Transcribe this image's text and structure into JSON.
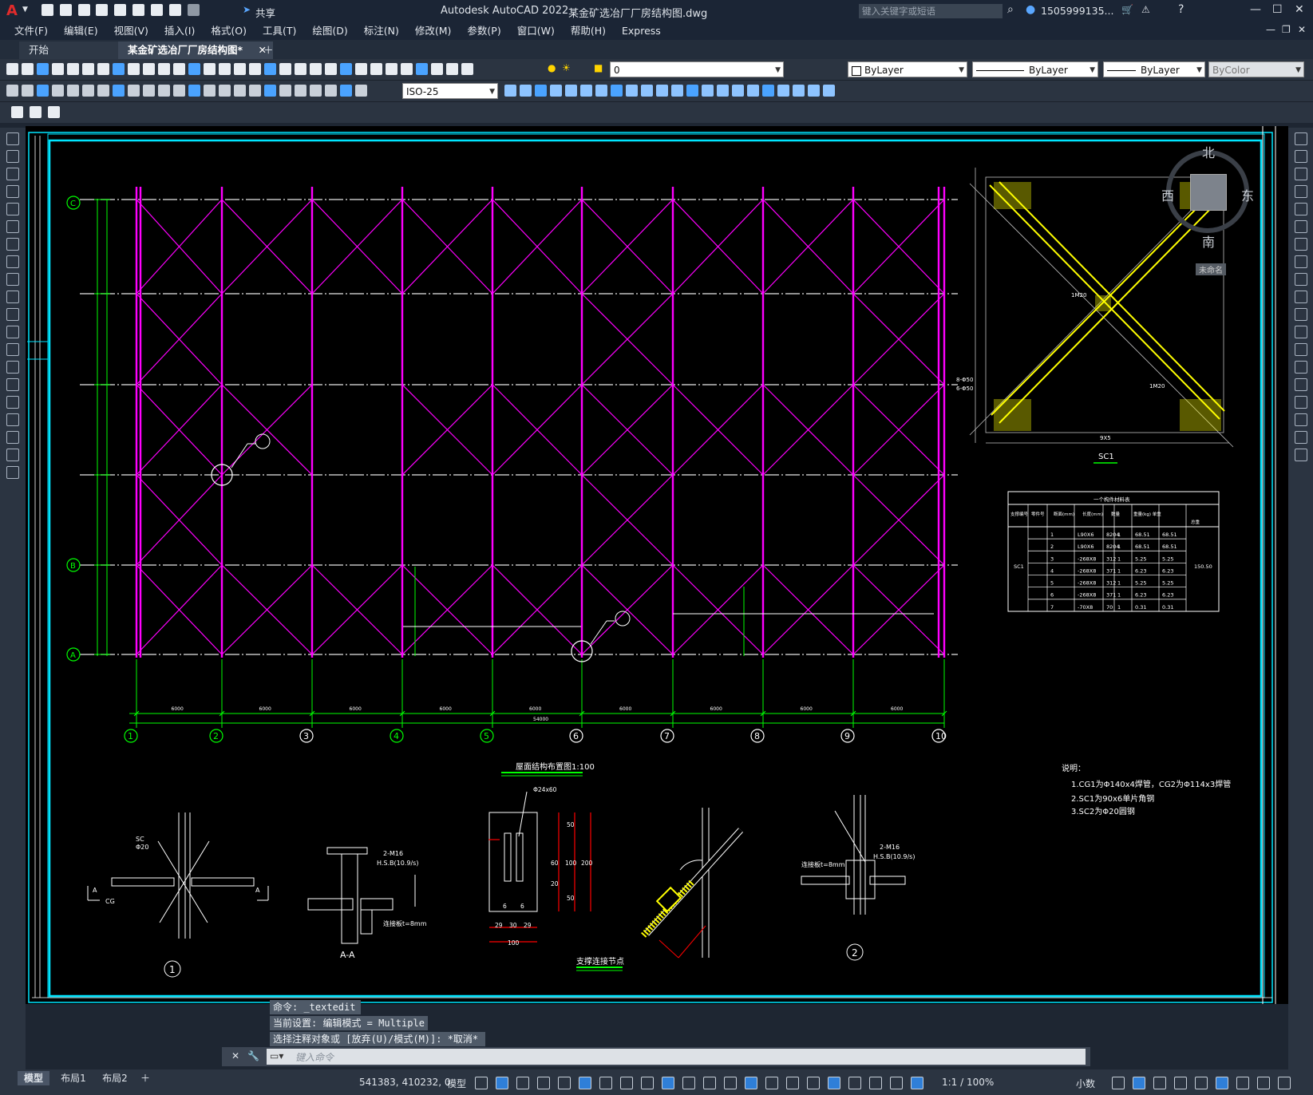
{
  "titlebar": {
    "app_title": "Autodesk AutoCAD 2022",
    "file_title": "某金矿选冶厂厂房结构图.dwg",
    "share_label": "共享",
    "search_placeholder": "键入关键字或短语",
    "user": "1505999135...",
    "min_glyph": "—",
    "max_glyph": "☐",
    "close_glyph": "✕",
    "logo": "A"
  },
  "menu": [
    "文件(F)",
    "编辑(E)",
    "视图(V)",
    "插入(I)",
    "格式(O)",
    "工具(T)",
    "绘图(D)",
    "标注(N)",
    "修改(M)",
    "参数(P)",
    "窗口(W)",
    "帮助(H)",
    "Express"
  ],
  "tabs": [
    {
      "label": "开始",
      "active": false
    },
    {
      "label": "某金矿选冶厂厂房结构图*",
      "active": true
    }
  ],
  "toolbar": {
    "layer_value": "0",
    "color_value": "ByLayer",
    "linetype_value": "ByLayer",
    "lineweight_value": "ByLayer",
    "plotstyle_value": "ByColor",
    "dimstyle_value": "ISO-25"
  },
  "drawing": {
    "plan_title": "屋面结构布置图1:100",
    "node_title": "支撑连接节点",
    "section_label": "A-A",
    "sc1_label": "SC1",
    "table_title": "一个构件材料表",
    "table_headers": [
      "支撑编号",
      "零件号",
      "断面(mm)",
      "长度(mm)",
      "数量",
      "重量(kg) 单重",
      "总重",
      "总重"
    ],
    "table_group": "SC1",
    "table_total": "150.50",
    "table_rows": [
      [
        "1",
        "L90X6",
        "8204",
        "1",
        "68.51",
        "68.51"
      ],
      [
        "2",
        "L90X6",
        "8204",
        "1",
        "68.51",
        "68.51"
      ],
      [
        "3",
        "-268X8",
        "312",
        "1",
        "5.25",
        "5.25"
      ],
      [
        "4",
        "-268X8",
        "371",
        "1",
        "6.23",
        "6.23"
      ],
      [
        "5",
        "-268X8",
        "312",
        "1",
        "5.25",
        "5.25"
      ],
      [
        "6",
        "-268X8",
        "371",
        "1",
        "6.23",
        "6.23"
      ],
      [
        "7",
        "-70X8",
        "70",
        "1",
        "0.31",
        "0.31"
      ]
    ],
    "notes_title": "说明：",
    "notes": [
      "1.CG1为Φ140x4焊管，CG2为Φ114x3焊管",
      "2.SC1为90x6单片角钢",
      "3.SC2为Φ20圆钢"
    ],
    "axis_numbers": [
      "1",
      "2",
      "3",
      "4",
      "5",
      "6",
      "7",
      "8",
      "9",
      "10"
    ],
    "axis_letters": [
      "C",
      "B",
      "A"
    ],
    "bay_dims": [
      "6000",
      "6000",
      "6000",
      "6000",
      "6000",
      "6000",
      "6000",
      "6000",
      "6000"
    ],
    "total_dim": "54000",
    "plate_dims": [
      "Φ24x60",
      "50",
      "60",
      "100",
      "20",
      "50",
      "200",
      "29",
      "30",
      "29",
      "100",
      "6",
      "6"
    ],
    "bolt_label": "2-M16",
    "bolt_grade": "H.S.B(10.9/s)",
    "gusset_label": "连接板t=8mm",
    "node_labels": [
      "SC",
      "Φ20",
      "CG",
      "A"
    ],
    "sc1_dims": [
      "1M20",
      "1M20",
      "8-Φ50",
      "6-Φ50",
      "9X5"
    ],
    "node_id_1": "1",
    "node_id_2": "2"
  },
  "viewcube": {
    "north": "北",
    "south": "南",
    "east": "东",
    "west": "西",
    "wcs": "未命名"
  },
  "command": {
    "history": [
      "命令: _textedit",
      "当前设置: 编辑模式 = Multiple",
      "选择注释对象或 [放弃(U)/模式(M)]: *取消*"
    ],
    "placeholder": "键入命令"
  },
  "layout_tabs": [
    "模型",
    "布局1",
    "布局2"
  ],
  "status": {
    "coords": "541383, 410232, 0",
    "model": "模型",
    "scale": "1:1 / 100%",
    "units": "小数"
  },
  "colors": {
    "magenta": "#ff00ff",
    "green": "#00ff00",
    "cyan": "#00e5ff",
    "yellow": "#ffff00",
    "red": "#ff0000",
    "white": "#ffffff"
  }
}
